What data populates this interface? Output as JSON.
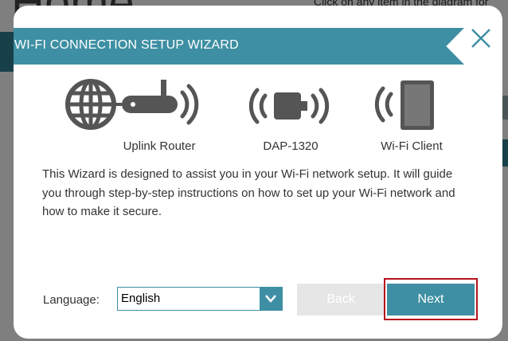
{
  "background": {
    "title_fragment": "Home",
    "hint_text": "Click on any item in the diagram for"
  },
  "wizard": {
    "title": "WI-FI CONNECTION SETUP WIZARD",
    "devices": [
      {
        "label": "Uplink Router",
        "icon": "router-globe-icon"
      },
      {
        "label": "DAP-1320",
        "icon": "extender-icon"
      },
      {
        "label": "Wi-Fi Client",
        "icon": "tablet-icon"
      }
    ],
    "description": "This Wizard is designed to assist you in your Wi-Fi network setup. It will guide you through step-by-step instructions on how to set up your Wi-Fi network and how to make it secure.",
    "language_label": "Language:",
    "language_value": "English",
    "back_label": "Back",
    "next_label": "Next"
  },
  "colors": {
    "accent": "#3e8fa3",
    "highlight_border": "#b5121b",
    "disabled": "#e6e6e6"
  }
}
